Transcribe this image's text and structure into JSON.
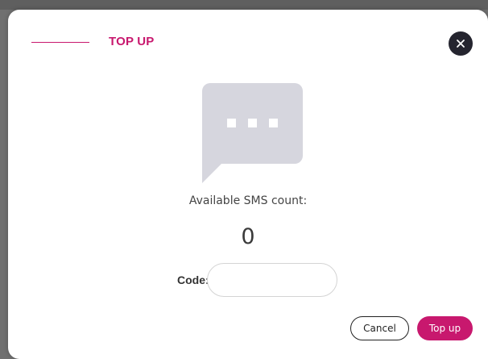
{
  "dialog": {
    "title": "TOP UP",
    "available_label": "Available SMS count:",
    "sms_count": "0",
    "code_label": "Code:",
    "code_value": "",
    "code_placeholder": "",
    "cancel_label": "Cancel",
    "topup_label": "Top up"
  },
  "icons": {
    "close": "close-icon",
    "sms": "chat-bubble-icon"
  },
  "colors": {
    "accent": "#c8186e",
    "close_button": "#25252f",
    "sms_icon": "#d6d6de"
  }
}
